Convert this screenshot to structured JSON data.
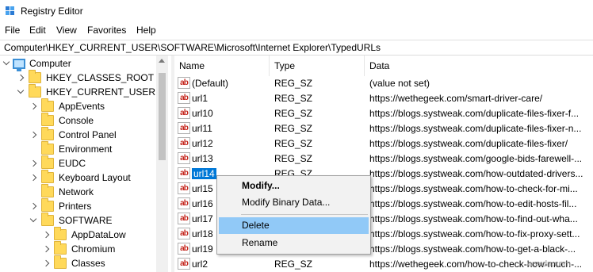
{
  "window": {
    "title": "Registry Editor"
  },
  "menu": [
    "File",
    "Edit",
    "View",
    "Favorites",
    "Help"
  ],
  "address": "Computer\\HKEY_CURRENT_USER\\SOFTWARE\\Microsoft\\Internet Explorer\\TypedURLs",
  "tree": {
    "root": "Computer",
    "nodes": [
      {
        "label": "HKEY_CLASSES_ROOT",
        "state": "collapsed"
      },
      {
        "label": "HKEY_CURRENT_USER",
        "state": "expanded"
      },
      {
        "label": "AppEvents",
        "state": "collapsed"
      },
      {
        "label": "Console",
        "state": "collapsed"
      },
      {
        "label": "Control Panel",
        "state": "collapsed"
      },
      {
        "label": "Environment",
        "state": "collapsed"
      },
      {
        "label": "EUDC",
        "state": "collapsed"
      },
      {
        "label": "Keyboard Layout",
        "state": "collapsed"
      },
      {
        "label": "Network",
        "state": "collapsed"
      },
      {
        "label": "Printers",
        "state": "collapsed"
      },
      {
        "label": "SOFTWARE",
        "state": "expanded"
      },
      {
        "label": "AppDataLow",
        "state": "collapsed"
      },
      {
        "label": "Chromium",
        "state": "collapsed"
      },
      {
        "label": "Classes",
        "state": "collapsed"
      }
    ]
  },
  "columns": {
    "name": "Name",
    "type": "Type",
    "data": "Data"
  },
  "rows": [
    {
      "name": "(Default)",
      "type": "REG_SZ",
      "data": "(value not set)"
    },
    {
      "name": "url1",
      "type": "REG_SZ",
      "data": "https://wethegeek.com/smart-driver-care/"
    },
    {
      "name": "url10",
      "type": "REG_SZ",
      "data": "https://blogs.systweak.com/duplicate-files-fixer-f..."
    },
    {
      "name": "url11",
      "type": "REG_SZ",
      "data": "https://blogs.systweak.com/duplicate-files-fixer-n..."
    },
    {
      "name": "url12",
      "type": "REG_SZ",
      "data": "https://blogs.systweak.com/duplicate-files-fixer/"
    },
    {
      "name": "url13",
      "type": "REG_SZ",
      "data": "https://blogs.systweak.com/google-bids-farewell-..."
    },
    {
      "name": "url14",
      "type": "REG_SZ",
      "data": "https://blogs.systweak.com/how-outdated-drivers..."
    },
    {
      "name": "url15",
      "type": "REG_SZ",
      "data": "https://blogs.systweak.com/how-to-check-for-mi..."
    },
    {
      "name": "url16",
      "type": "REG_SZ",
      "data": "https://blogs.systweak.com/how-to-edit-hosts-fil..."
    },
    {
      "name": "url17",
      "type": "REG_SZ",
      "data": "https://blogs.systweak.com/how-to-find-out-wha..."
    },
    {
      "name": "url18",
      "type": "REG_SZ",
      "data": "https://blogs.systweak.com/how-to-fix-proxy-sett..."
    },
    {
      "name": "url19",
      "type": "REG_SZ",
      "data": "https://blogs.systweak.com/how-to-get-a-black-..."
    },
    {
      "name": "url2",
      "type": "REG_SZ",
      "data": "https://wethegeek.com/how-to-check-how-much-..."
    }
  ],
  "context_menu": {
    "modify": "Modify...",
    "modify_binary": "Modify Binary Data...",
    "delete": "Delete",
    "rename": "Rename"
  },
  "watermark": "wsxdn.com"
}
